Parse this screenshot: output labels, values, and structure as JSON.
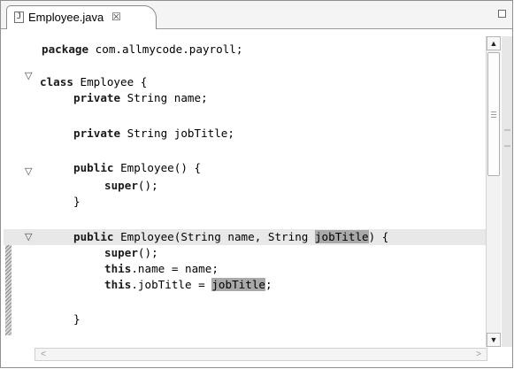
{
  "tab": {
    "icon": "java-file-icon",
    "label": "Employee.java",
    "close": "☒"
  },
  "editor": {
    "lines": [
      {
        "t": "package",
        "rest": " com.allmycode.payroll;"
      },
      {
        "t": "class",
        "rest": " Employee {"
      },
      {
        "t": "private",
        "rest": " String name;"
      },
      {
        "t": "private",
        "rest": " String jobTitle;"
      },
      {
        "t": "public",
        "rest": " Employee() {"
      },
      {
        "t": "super",
        "rest": "();"
      },
      {
        "t": "",
        "rest": "}"
      },
      {
        "t": "public",
        "rest": " Employee(String name, String ",
        "hl": "jobTitle",
        "after": ") {"
      },
      {
        "t": "super",
        "rest": "();"
      },
      {
        "t": "this",
        "rest": ".name = name;"
      },
      {
        "t": "this",
        "rest": ".jobTitle = ",
        "hl": "jobTitle",
        "after": ";"
      },
      {
        "t": "",
        "rest": "}"
      }
    ]
  },
  "scrollbars": {
    "up": "▲",
    "down": "▼",
    "left": "<",
    "right": ">"
  }
}
